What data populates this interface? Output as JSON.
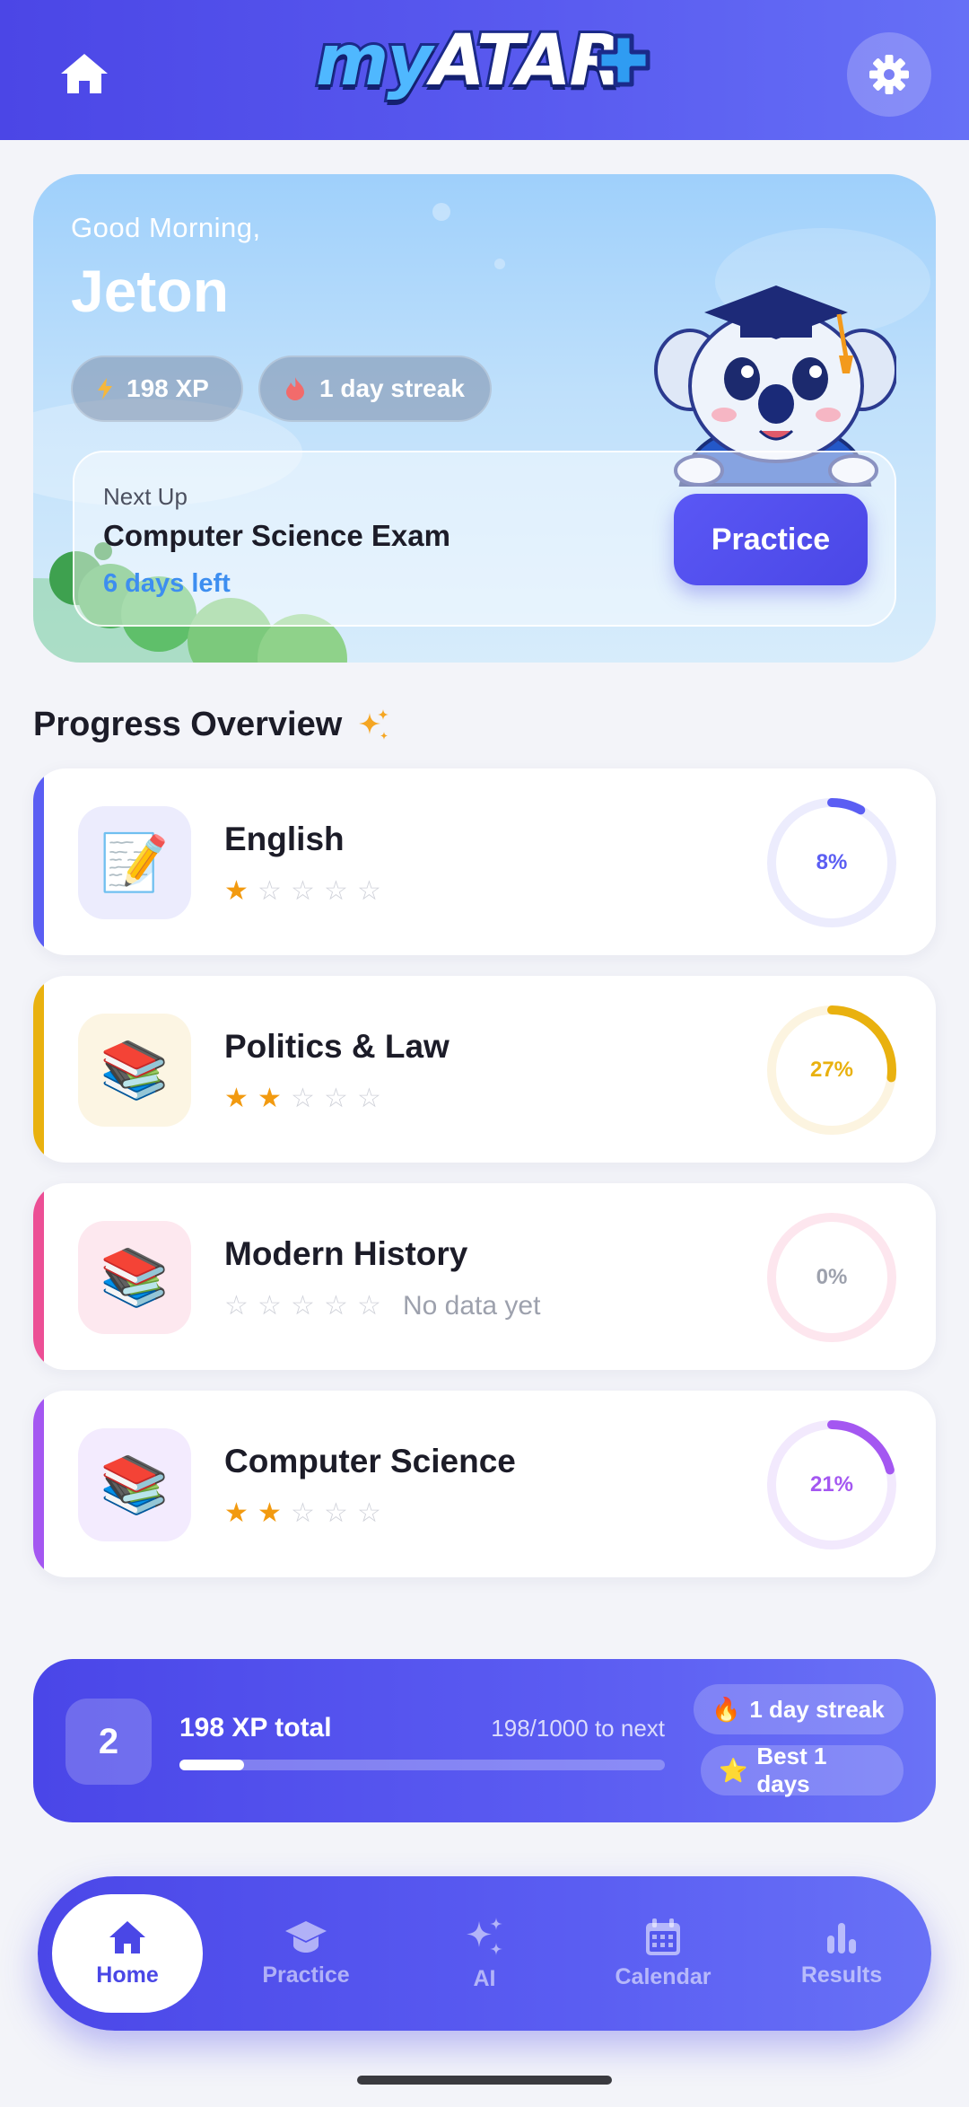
{
  "header": {
    "logo_text_my": "my",
    "logo_text_atar": "ATAR",
    "home_icon": "home-icon",
    "settings_icon": "gear-icon"
  },
  "hero": {
    "greeting": "Good Morning,",
    "name": "Jeton",
    "xp_chip": "198 XP",
    "streak_chip": "1 day streak",
    "next_up": {
      "label": "Next Up",
      "title": "Computer Science Exam",
      "days_left": "6 days left",
      "button_label": "Practice"
    }
  },
  "progress": {
    "title": "Progress Overview",
    "subjects": [
      {
        "name": "English",
        "icon": "memo-pencil-icon",
        "stars": 1,
        "max_stars": 5,
        "percent_label": "8%",
        "percent": 8,
        "accent": "#5b5ef3",
        "tile_bg": "#ececfd",
        "ring_track": "#ececfd",
        "note": ""
      },
      {
        "name": "Politics & Law",
        "icon": "books-icon",
        "stars": 2,
        "max_stars": 5,
        "percent_label": "27%",
        "percent": 27,
        "accent": "#e9b10f",
        "tile_bg": "#fcf5e3",
        "ring_track": "#fcf4e0",
        "note": ""
      },
      {
        "name": "Modern History",
        "icon": "books-icon",
        "stars": 0,
        "max_stars": 5,
        "percent_label": "0%",
        "percent": 0,
        "accent": "#ec4f95",
        "tile_bg": "#fde8ef",
        "ring_track": "#fde6ee",
        "note": "No data yet"
      },
      {
        "name": "Computer Science",
        "icon": "books-icon",
        "stars": 2,
        "max_stars": 5,
        "percent_label": "21%",
        "percent": 21,
        "accent": "#a457f1",
        "tile_bg": "#f3ebfe",
        "ring_track": "#f2e9fd",
        "note": ""
      }
    ]
  },
  "xp_bar": {
    "level": "2",
    "total_label": "198 XP total",
    "next_label": "198/1000 to next",
    "progress_fraction": 0.134,
    "streak_pill": "1 day streak",
    "best_pill": "Best 1 days"
  },
  "nav": {
    "items": [
      {
        "label": "Home",
        "icon": "home-icon",
        "active": true
      },
      {
        "label": "Practice",
        "icon": "graduation-cap-icon",
        "active": false
      },
      {
        "label": "AI",
        "icon": "sparkle-icon",
        "active": false
      },
      {
        "label": "Calendar",
        "icon": "calendar-icon",
        "active": false
      },
      {
        "label": "Results",
        "icon": "bar-chart-icon",
        "active": false
      }
    ]
  },
  "colors": {
    "brand": "#4b46e6",
    "star_on": "#f29a10",
    "next_up_days": "#3d8ef0"
  }
}
